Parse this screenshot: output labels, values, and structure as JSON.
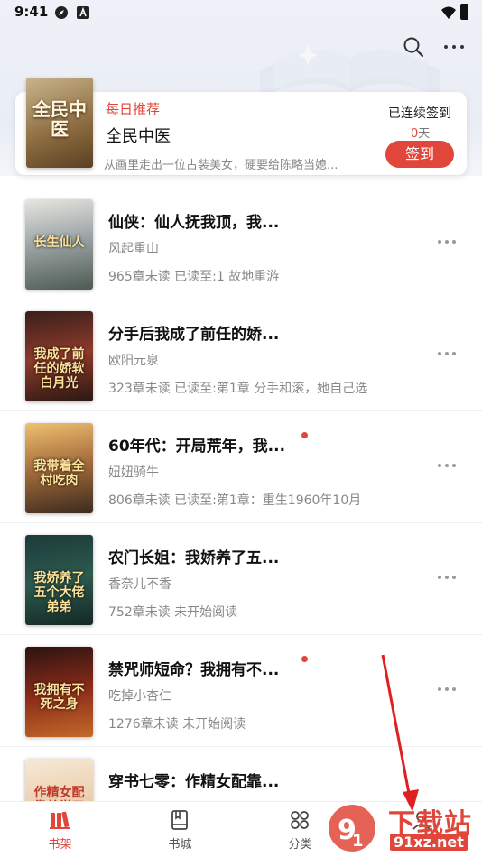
{
  "status_bar": {
    "time": "9:41"
  },
  "recommendation": {
    "tag": "每日推荐",
    "title": "全民中医",
    "cover_text": "全民中医",
    "description": "从画里走出一位古装美女，硬要给陈略当媳...",
    "signin_label": "已连续签到",
    "signin_days_value": "0",
    "signin_days_unit": "天",
    "signin_button": "签到"
  },
  "books": [
    {
      "title": "仙侠：仙人抚我顶，我...",
      "author": "风起重山",
      "progress": "965章未读 已读至:1 故地重游",
      "cover_text": "长生仙人",
      "has_dot": false
    },
    {
      "title": "分手后我成了前任的娇...",
      "author": "欧阳元泉",
      "progress": "323章未读 已读至:第1章 分手和滚，她自己选",
      "cover_text": "我成了前任的娇软白月光",
      "has_dot": false
    },
    {
      "title": "60年代：开局荒年，我...",
      "author": "妞妞骑牛",
      "progress": "806章未读 已读至:第1章：重生1960年10月",
      "cover_text": "我带着全村吃肉",
      "has_dot": true
    },
    {
      "title": "农门长姐：我娇养了五...",
      "author": "香奈儿不香",
      "progress": "752章未读 未开始阅读",
      "cover_text": "我娇养了五个大佬弟弟",
      "has_dot": false
    },
    {
      "title": "禁咒师短命？我拥有不...",
      "author": "吃掉小杏仁",
      "progress": "1276章未读 未开始阅读",
      "cover_text": "我拥有不死之身",
      "has_dot": true
    },
    {
      "title": "穿书七零：作精女配靠...",
      "author": "",
      "progress": "",
      "cover_text": "作精女配靠着学习暴富",
      "has_dot": false
    }
  ],
  "bottom_nav": [
    {
      "label": "书架",
      "icon": "bookshelf-icon",
      "active": true
    },
    {
      "label": "书城",
      "icon": "book-icon",
      "active": false
    },
    {
      "label": "分类",
      "icon": "category-icon",
      "active": false
    },
    {
      "label": "",
      "icon": "profile-icon",
      "active": false
    }
  ],
  "watermark": {
    "text": "下载站",
    "url": "91xz.net"
  },
  "colors": {
    "accent": "#e0473a",
    "header_bg": "#eef1f7",
    "muted_text": "#888888"
  }
}
